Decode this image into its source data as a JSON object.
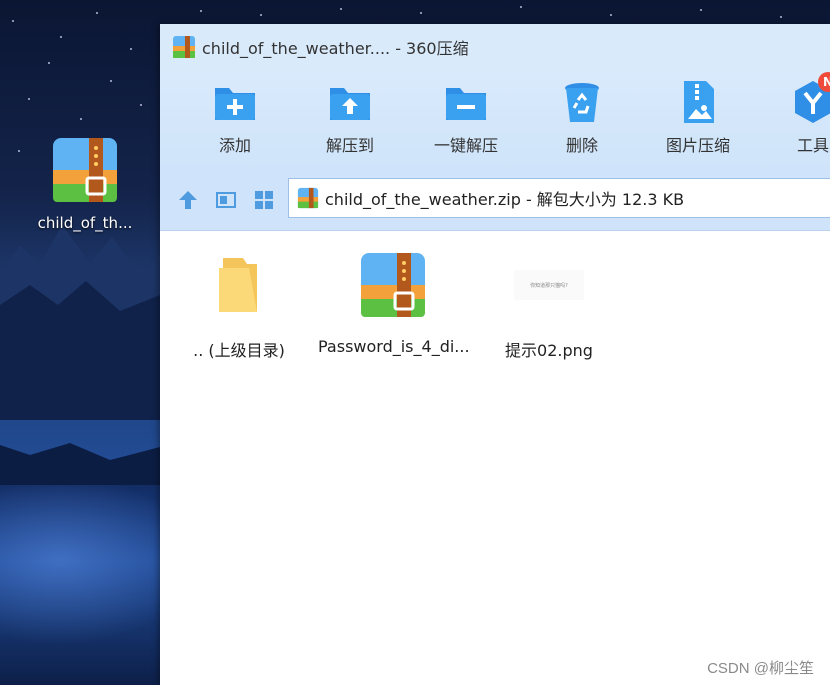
{
  "desktop": {
    "icon_label": "child_of_th..."
  },
  "window": {
    "title": "child_of_the_weather.... - 360压缩",
    "toolbar": [
      {
        "label": "添加",
        "icon": "add-folder-icon"
      },
      {
        "label": "解压到",
        "icon": "extract-to-icon"
      },
      {
        "label": "一键解压",
        "icon": "one-click-extract-icon"
      },
      {
        "label": "删除",
        "icon": "recycle-bin-icon"
      },
      {
        "label": "图片压缩",
        "icon": "image-compress-icon"
      },
      {
        "label": "工具",
        "icon": "tools-icon"
      }
    ],
    "tools_badge": "N",
    "address": "child_of_the_weather.zip - 解包大小为 12.3 KB",
    "files": [
      {
        "name": ".. (上级目录)",
        "type": "folder"
      },
      {
        "name": "Password_is_4_di...",
        "type": "zip"
      },
      {
        "name": "提示02.png",
        "type": "image"
      }
    ],
    "image_thumb_text": "你知道那只猫吗?"
  },
  "watermark": "CSDN @柳尘笙",
  "colors": {
    "toolbar_bg": "#d9eafb",
    "icon_blue": "#2f8ee6",
    "zip_orange": "#f3a23b",
    "zip_green": "#5cc043",
    "zip_blue": "#5fb3f2"
  }
}
